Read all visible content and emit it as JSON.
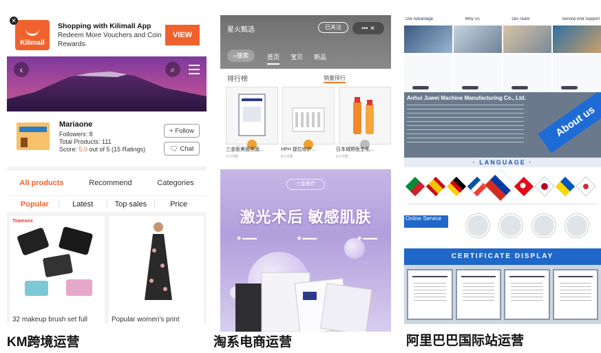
{
  "kilimall": {
    "banner_title": "Shopping with Kilimall App",
    "banner_text": "Redeem More Vouchers and Coin Rewards.",
    "logo_text": "Kilimall",
    "view_button": "VIEW",
    "store_name": "Mariaone",
    "followers": "Followers: 8",
    "total_products": "Total Products: 111",
    "score_prefix": "Score: ",
    "score_value": "5.0",
    "score_suffix": " out of 5 (15 Ratings)",
    "follow_button": "+ Follow",
    "chat_button": "Chat",
    "tabs": [
      "All products",
      "Recommend",
      "Categories"
    ],
    "sorts": [
      "Popular",
      "Latest",
      "Top sales",
      "Price"
    ],
    "products": [
      "32 makeup brush set full",
      "Popular women's print"
    ],
    "product_brand": "Teamvox",
    "accent_color": "#f0622d"
  },
  "taobao": {
    "shop_title": "星火甄选",
    "follow_button": "已关注",
    "search_label": "搜索",
    "nav": [
      "首页",
      "宝贝",
      "新品"
    ],
    "rank_title": "排行榜",
    "rank_tab": "销量排行",
    "rank_items": [
      "三金医美面用面...",
      "HPH 提拉修护...",
      "日本城野医生毛..."
    ],
    "rank_sales": [
      "7人付款",
      "6人付款",
      "6人付款"
    ],
    "promo_pill": "三金医疗",
    "promo_title": "激光术后 敏感肌肤"
  },
  "alibaba": {
    "headers": [
      "Our Advantage",
      "Why Us",
      "Our Team",
      "Service And Support"
    ],
    "company_name": "Anhui Juwei Machine Manufacturing Co., Ltd.",
    "about_label": "About us",
    "language_label": "· LANGUAGE ·",
    "online_service": "Online Service",
    "certificate_label": "CERTIFICATE DISPLAY"
  },
  "captions": [
    "KM跨境运营",
    "淘系电商运营",
    "阿里巴巴国际站运营"
  ]
}
